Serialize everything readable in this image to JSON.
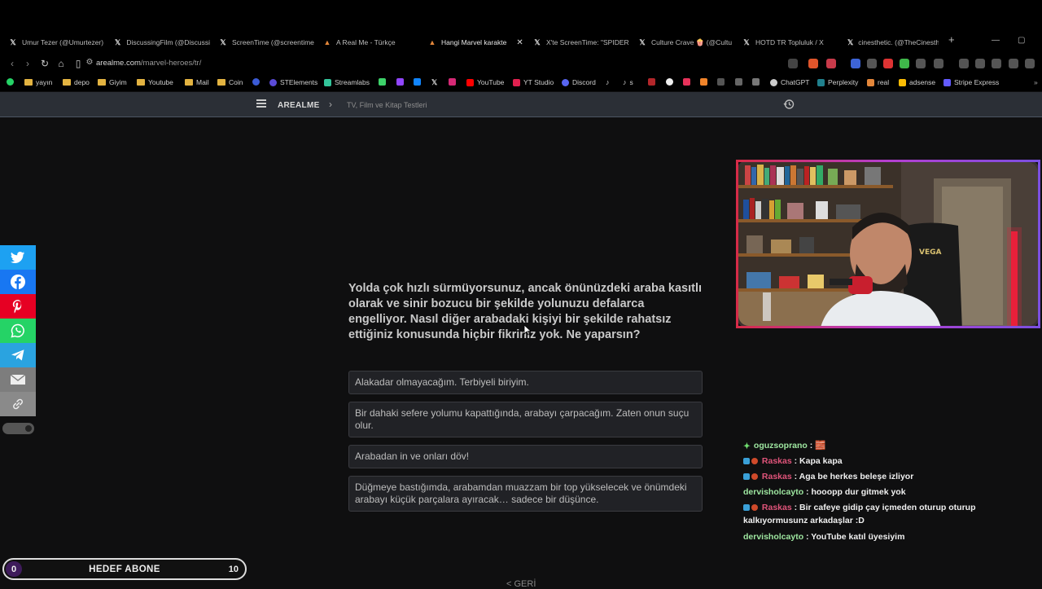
{
  "browser": {
    "tabs": [
      {
        "label": "Umur Tezer (@Umurtezer)",
        "icon": "x-logo"
      },
      {
        "label": "DiscussingFilm (@Discussi",
        "icon": "x-logo"
      },
      {
        "label": "ScreenTime (@screentime",
        "icon": "x-logo"
      },
      {
        "label": "A Real Me - Türkçe",
        "icon": "fox-icon"
      },
      {
        "label": "Hangi Marvel karakte",
        "icon": "fox-icon",
        "active": true
      },
      {
        "label": "X'te ScreenTime: \"SPIDER",
        "icon": "x-logo"
      },
      {
        "label": "Culture Crave 🍿 (@Cultu",
        "icon": "x-logo"
      },
      {
        "label": "HOTD TR Topluluk / X",
        "icon": "x-logo"
      },
      {
        "label": "cinesthetic. (@TheCinesth",
        "icon": "x-logo"
      }
    ],
    "url_host": "arealme.com",
    "url_path": "/marvel-heroes/tr/",
    "bookmarks": [
      {
        "label": "",
        "icon": "whatsapp-icon"
      },
      {
        "label": "yayın",
        "icon": "folder-icon"
      },
      {
        "label": "depo",
        "icon": "folder-icon"
      },
      {
        "label": "Giyim",
        "icon": "folder-icon"
      },
      {
        "label": "Youtube",
        "icon": "folder-icon"
      },
      {
        "label": "Mail",
        "icon": "folder-icon"
      },
      {
        "label": "Coin",
        "icon": "folder-icon"
      },
      {
        "label": "STElements",
        "icon": "st-icon"
      },
      {
        "label": "Streamlabs",
        "icon": "streamlabs-icon"
      },
      {
        "label": "YouTube",
        "icon": "youtube-icon"
      },
      {
        "label": "YT Studio",
        "icon": "ytstudio-icon"
      },
      {
        "label": "Discord",
        "icon": "discord-icon"
      },
      {
        "label": "s",
        "icon": "tiktok-icon"
      },
      {
        "label": "ChatGPT",
        "icon": "chatgpt-icon"
      },
      {
        "label": "Perplexity",
        "icon": "perplexity-icon"
      },
      {
        "label": "real",
        "icon": "fox-icon"
      },
      {
        "label": "adsense",
        "icon": "adsense-icon"
      },
      {
        "label": "Stripe Express",
        "icon": "stripe-icon"
      }
    ]
  },
  "site": {
    "brand": "AREALME",
    "breadcrumb": "TV, Film ve Kitap Testleri"
  },
  "quiz": {
    "question": "Yolda çok hızlı sürmüyorsunuz, ancak önünüzdeki araba kasıtlı olarak ve sinir bozucu bir şekilde yolunuzu defalarca engelliyor. Nasıl diğer arabadaki kişiyi bir şekilde rahatsız ettiğiniz konusunda hiçbir fikriniz yok. Ne yaparsın?",
    "answers": [
      "Alakadar olmayacağım. Terbiyeli biriyim.",
      "Bir dahaki sefere yolumu kapattığında, arabayı çarpacağım. Zaten onun suçu olur.",
      "Arabadan in ve onları döv!",
      "Düğmeye bastığımda, arabamdan muazzam bir top yükselecek ve önümdeki arabayı küçük parçalara ayıracak… sadece bir düşünce."
    ],
    "back_label": "< GERİ"
  },
  "share": [
    "twitter-icon",
    "facebook-icon",
    "pinterest-icon",
    "whatsapp-icon",
    "telegram-icon",
    "email-icon",
    "link-icon"
  ],
  "chat": [
    {
      "user": "oguzsoprano",
      "text": "🧱",
      "color": "green"
    },
    {
      "user": "Raskas",
      "text": "Kapa kapa",
      "color": "red"
    },
    {
      "user": "Raskas",
      "text": "Aga be herkes beleşe izliyor",
      "color": "red"
    },
    {
      "user": "dervisholcayto",
      "text": "hooopp dur gitmek yok",
      "color": "green"
    },
    {
      "user": "Raskas",
      "text": "Bir cafeye gidip çay içmeden oturup oturup kalkıyormusunz arkadaşlar :D",
      "color": "red"
    },
    {
      "user": "dervisholcayto",
      "text": "YouTube katıl üyesiyim",
      "color": "green"
    }
  ],
  "goal": {
    "label": "HEDEF ABONE",
    "current": "0",
    "target": "10",
    "progress": 0
  },
  "colors": {
    "header_bg": "#2b2f36",
    "twitter": "#1da1f2",
    "facebook": "#1877f2",
    "pinterest": "#e60023",
    "whatsapp": "#25d366",
    "telegram": "#2aa3e0",
    "email": "#7d7d7d",
    "link": "#8a8a8a"
  }
}
